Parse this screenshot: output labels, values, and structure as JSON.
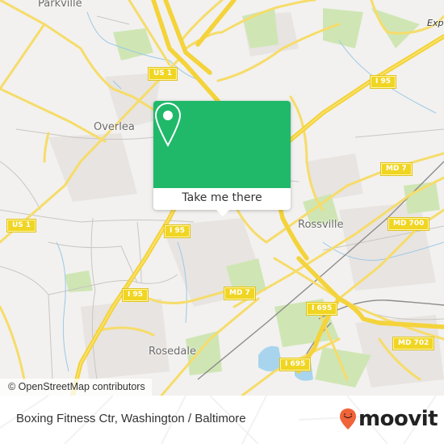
{
  "map": {
    "places": [
      {
        "id": "parkville",
        "label": "Parkville"
      },
      {
        "id": "overlea",
        "label": "Overlea"
      },
      {
        "id": "rossville",
        "label": "Rossville"
      },
      {
        "id": "rosedale",
        "label": "Rosedale"
      },
      {
        "id": "exp",
        "label": "Exp"
      }
    ],
    "shields": [
      {
        "id": "us1-top",
        "label": "US 1"
      },
      {
        "id": "i95-top",
        "label": "I 95"
      },
      {
        "id": "md7-top",
        "label": "MD 7"
      },
      {
        "id": "md700",
        "label": "MD 700"
      },
      {
        "id": "us1-left",
        "label": "US 1"
      },
      {
        "id": "i95-mid",
        "label": "I 95"
      },
      {
        "id": "i95-low",
        "label": "I 95"
      },
      {
        "id": "md7-mid",
        "label": "MD 7"
      },
      {
        "id": "i695-a",
        "label": "I 695"
      },
      {
        "id": "md702",
        "label": "MD 702"
      },
      {
        "id": "i695-b",
        "label": "I 695"
      }
    ],
    "attribution": "© OpenStreetMap contributors"
  },
  "popup": {
    "icon": "map-pin-icon",
    "button_label": "Take me there",
    "color": "#20b96a"
  },
  "footer": {
    "title": "Boxing Fitness Ctr, Washington / Baltimore",
    "logo_text": "moovit",
    "logo_color": "#f0643a"
  }
}
